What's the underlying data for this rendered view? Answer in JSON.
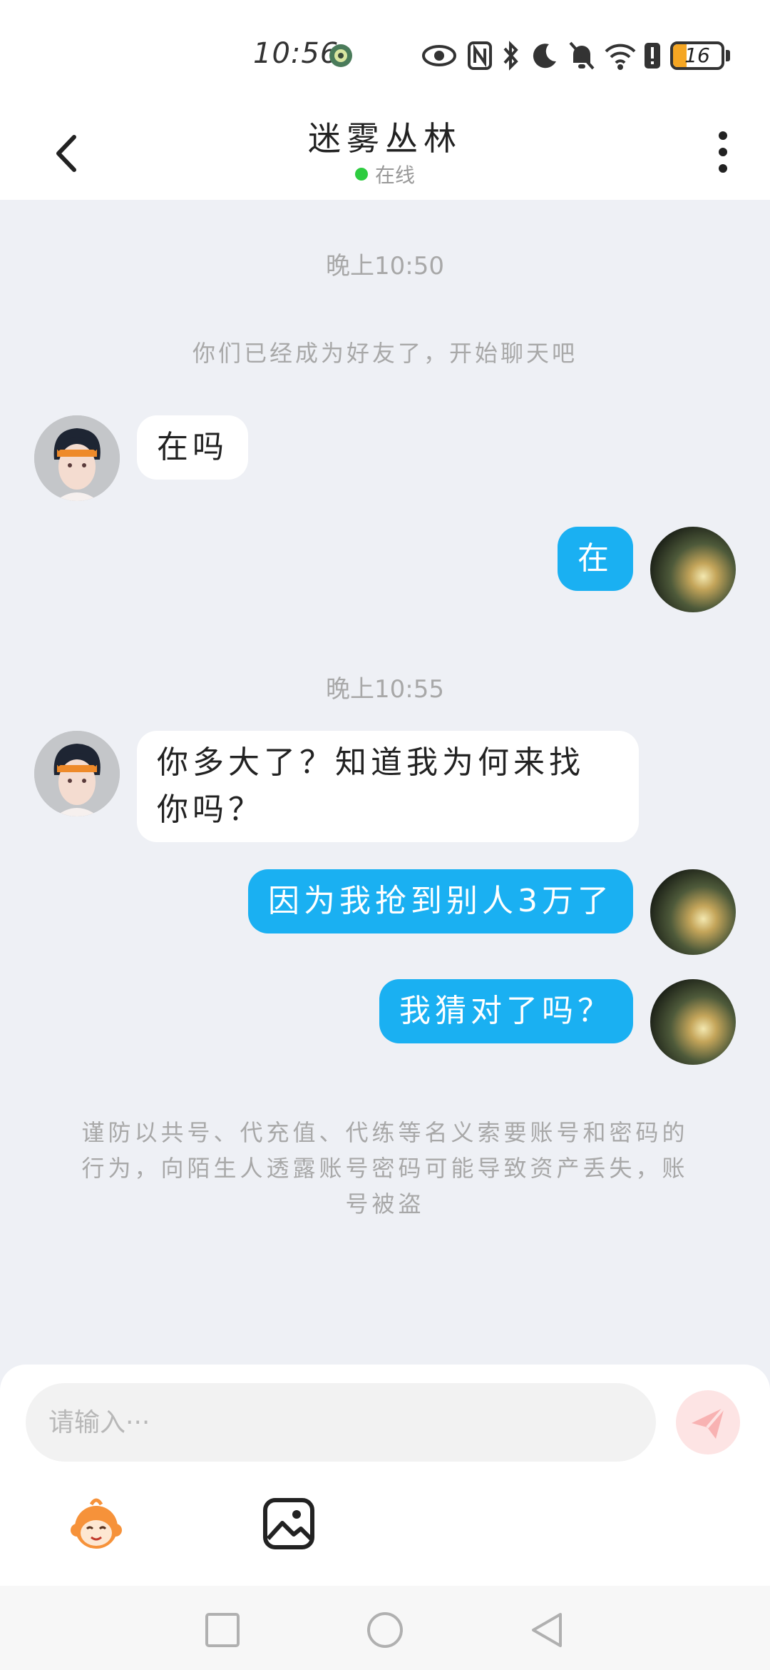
{
  "status_bar": {
    "time": "10:56",
    "battery": "16",
    "battery_level": 0.16,
    "icons": [
      "eye-icon",
      "nfc-icon",
      "bluetooth-icon",
      "moon-icon",
      "mute-bell-icon",
      "wifi-icon",
      "alert-icon",
      "battery-icon"
    ]
  },
  "header": {
    "title": "迷雾丛林",
    "status": "在线"
  },
  "chat": {
    "time_1": "晚上10:50",
    "system_friend": "你们已经成为好友了，开始聊天吧",
    "msg_1": "在吗",
    "msg_2": "在",
    "time_2": "晚上10:55",
    "msg_3_line1": "你多大了？知道我为何来找",
    "msg_3_line2": "你吗？",
    "msg_4": "因为我抢到别人3万了",
    "msg_5": "我猜对了吗？",
    "warning": "谨防以共号、代充值、代练等名义索要账号和密码的行为，向陌生人透露账号密码可能导致资产丢失，账号被盗"
  },
  "input": {
    "placeholder": "请输入···"
  },
  "colors": {
    "accent": "#1ab0f2",
    "online": "#2ecc40",
    "background": "#eef0f5",
    "send_button": "#fde4e4"
  }
}
